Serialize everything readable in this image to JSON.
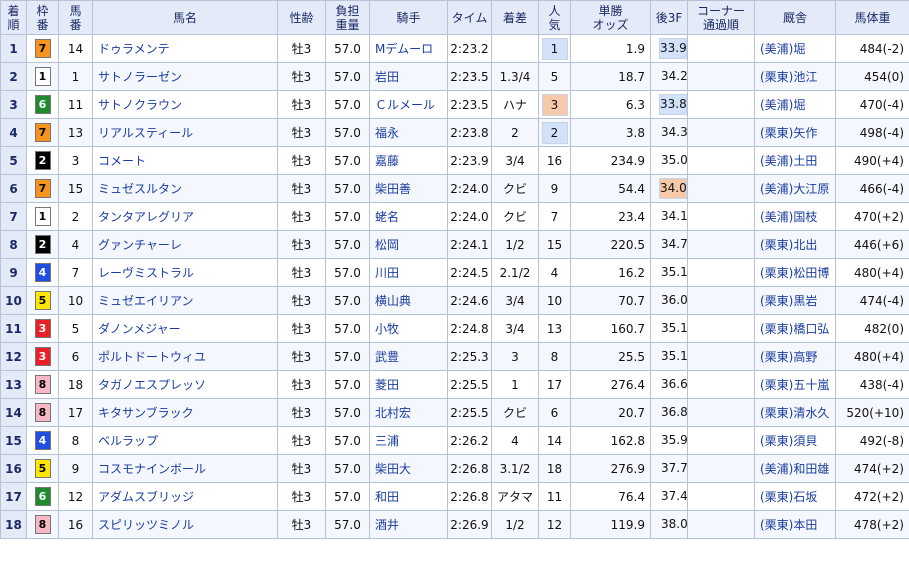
{
  "headers": {
    "rank": [
      "着",
      "順"
    ],
    "frame": [
      "枠",
      "番"
    ],
    "num": [
      "馬",
      "番"
    ],
    "name": "馬名",
    "sexage": "性齢",
    "weight": [
      "負担",
      "重量"
    ],
    "jockey": "騎手",
    "time": "タイム",
    "margin": "着差",
    "pop": [
      "人",
      "気"
    ],
    "odds": [
      "単勝",
      "オッズ"
    ],
    "last3f": "後3F",
    "corner": [
      "コーナー",
      "通過順"
    ],
    "trainer": "厩舎",
    "bodyweight": "馬体重"
  },
  "frame_colors": {
    "1": {
      "bg": "#ffffff",
      "fg": "#000000"
    },
    "2": {
      "bg": "#000000",
      "fg": "#ffffff"
    },
    "3": {
      "bg": "#e8202a",
      "fg": "#ffffff"
    },
    "4": {
      "bg": "#1f4ee0",
      "fg": "#ffffff"
    },
    "5": {
      "bg": "#ffe600",
      "fg": "#000000"
    },
    "6": {
      "bg": "#1f8a2e",
      "fg": "#ffffff"
    },
    "7": {
      "bg": "#f7941d",
      "fg": "#000000"
    },
    "8": {
      "bg": "#f5b8c4",
      "fg": "#000000"
    }
  },
  "highlight_colors": {
    "first": "#d2e2fb",
    "second": "#d2e2fb",
    "third": "#f6c9a8",
    "last_first": "#d2e2fb",
    "last_third": "#f6c9a8"
  },
  "rows": [
    {
      "rank": "1",
      "frame": "7",
      "num": "14",
      "name": "ドゥラメンテ",
      "sexage": "牡3",
      "weight": "57.0",
      "jockey": "Mデムーロ",
      "time": "2:23.2",
      "margin": "",
      "pop": "1",
      "pop_hl": "first",
      "odds": "1.9",
      "last3f": "33.9",
      "last_hl": "last_first",
      "corner": "",
      "trainer": "(美浦)堀",
      "bodyweight": "484(-2)"
    },
    {
      "rank": "2",
      "frame": "1",
      "num": "1",
      "name": "サトノラーゼン",
      "sexage": "牡3",
      "weight": "57.0",
      "jockey": "岩田",
      "time": "2:23.5",
      "margin": "1.3/4",
      "pop": "5",
      "pop_hl": "",
      "odds": "18.7",
      "last3f": "34.2",
      "last_hl": "",
      "corner": "",
      "trainer": "(栗東)池江",
      "bodyweight": "454(0)"
    },
    {
      "rank": "3",
      "frame": "6",
      "num": "11",
      "name": "サトノクラウン",
      "sexage": "牡3",
      "weight": "57.0",
      "jockey": "Ｃルメール",
      "time": "2:23.5",
      "margin": "ハナ",
      "pop": "3",
      "pop_hl": "third",
      "odds": "6.3",
      "last3f": "33.8",
      "last_hl": "last_first",
      "corner": "",
      "trainer": "(美浦)堀",
      "bodyweight": "470(-4)"
    },
    {
      "rank": "4",
      "frame": "7",
      "num": "13",
      "name": "リアルスティール",
      "sexage": "牡3",
      "weight": "57.0",
      "jockey": "福永",
      "time": "2:23.8",
      "margin": "2",
      "pop": "2",
      "pop_hl": "second",
      "odds": "3.8",
      "last3f": "34.3",
      "last_hl": "",
      "corner": "",
      "trainer": "(栗東)矢作",
      "bodyweight": "498(-4)"
    },
    {
      "rank": "5",
      "frame": "2",
      "num": "3",
      "name": "コメート",
      "sexage": "牡3",
      "weight": "57.0",
      "jockey": "嘉藤",
      "time": "2:23.9",
      "margin": "3/4",
      "pop": "16",
      "pop_hl": "",
      "odds": "234.9",
      "last3f": "35.0",
      "last_hl": "",
      "corner": "",
      "trainer": "(美浦)土田",
      "bodyweight": "490(+4)"
    },
    {
      "rank": "6",
      "frame": "7",
      "num": "15",
      "name": "ミュゼスルタン",
      "sexage": "牡3",
      "weight": "57.0",
      "jockey": "柴田善",
      "time": "2:24.0",
      "margin": "クビ",
      "pop": "9",
      "pop_hl": "",
      "odds": "54.4",
      "last3f": "34.0",
      "last_hl": "last_third",
      "corner": "",
      "trainer": "(美浦)大江原",
      "bodyweight": "466(-4)"
    },
    {
      "rank": "7",
      "frame": "1",
      "num": "2",
      "name": "タンタアレグリア",
      "sexage": "牡3",
      "weight": "57.0",
      "jockey": "蛯名",
      "time": "2:24.0",
      "margin": "クビ",
      "pop": "7",
      "pop_hl": "",
      "odds": "23.4",
      "last3f": "34.1",
      "last_hl": "",
      "corner": "",
      "trainer": "(美浦)国枝",
      "bodyweight": "470(+2)"
    },
    {
      "rank": "8",
      "frame": "2",
      "num": "4",
      "name": "グァンチャーレ",
      "sexage": "牡3",
      "weight": "57.0",
      "jockey": "松岡",
      "time": "2:24.1",
      "margin": "1/2",
      "pop": "15",
      "pop_hl": "",
      "odds": "220.5",
      "last3f": "34.7",
      "last_hl": "",
      "corner": "",
      "trainer": "(栗東)北出",
      "bodyweight": "446(+6)"
    },
    {
      "rank": "9",
      "frame": "4",
      "num": "7",
      "name": "レーヴミストラル",
      "sexage": "牡3",
      "weight": "57.0",
      "jockey": "川田",
      "time": "2:24.5",
      "margin": "2.1/2",
      "pop": "4",
      "pop_hl": "",
      "odds": "16.2",
      "last3f": "35.1",
      "last_hl": "",
      "corner": "",
      "trainer": "(栗東)松田博",
      "bodyweight": "480(+4)"
    },
    {
      "rank": "10",
      "frame": "5",
      "num": "10",
      "name": "ミュゼエイリアン",
      "sexage": "牡3",
      "weight": "57.0",
      "jockey": "横山典",
      "time": "2:24.6",
      "margin": "3/4",
      "pop": "10",
      "pop_hl": "",
      "odds": "70.7",
      "last3f": "36.0",
      "last_hl": "",
      "corner": "",
      "trainer": "(栗東)黒岩",
      "bodyweight": "474(-4)"
    },
    {
      "rank": "11",
      "frame": "3",
      "num": "5",
      "name": "ダノンメジャー",
      "sexage": "牡3",
      "weight": "57.0",
      "jockey": "小牧",
      "time": "2:24.8",
      "margin": "3/4",
      "pop": "13",
      "pop_hl": "",
      "odds": "160.7",
      "last3f": "35.1",
      "last_hl": "",
      "corner": "",
      "trainer": "(栗東)橋口弘",
      "bodyweight": "482(0)"
    },
    {
      "rank": "12",
      "frame": "3",
      "num": "6",
      "name": "ポルトドートウィユ",
      "sexage": "牡3",
      "weight": "57.0",
      "jockey": "武豊",
      "time": "2:25.3",
      "margin": "3",
      "pop": "8",
      "pop_hl": "",
      "odds": "25.5",
      "last3f": "35.1",
      "last_hl": "",
      "corner": "",
      "trainer": "(栗東)高野",
      "bodyweight": "480(+4)"
    },
    {
      "rank": "13",
      "frame": "8",
      "num": "18",
      "name": "タガノエスプレッソ",
      "sexage": "牡3",
      "weight": "57.0",
      "jockey": "菱田",
      "time": "2:25.5",
      "margin": "1",
      "pop": "17",
      "pop_hl": "",
      "odds": "276.4",
      "last3f": "36.6",
      "last_hl": "",
      "corner": "",
      "trainer": "(栗東)五十嵐",
      "bodyweight": "438(-4)"
    },
    {
      "rank": "14",
      "frame": "8",
      "num": "17",
      "name": "キタサンブラック",
      "sexage": "牡3",
      "weight": "57.0",
      "jockey": "北村宏",
      "time": "2:25.5",
      "margin": "クビ",
      "pop": "6",
      "pop_hl": "",
      "odds": "20.7",
      "last3f": "36.8",
      "last_hl": "",
      "corner": "",
      "trainer": "(栗東)清水久",
      "bodyweight": "520(+10)"
    },
    {
      "rank": "15",
      "frame": "4",
      "num": "8",
      "name": "ベルラップ",
      "sexage": "牡3",
      "weight": "57.0",
      "jockey": "三浦",
      "time": "2:26.2",
      "margin": "4",
      "pop": "14",
      "pop_hl": "",
      "odds": "162.8",
      "last3f": "35.9",
      "last_hl": "",
      "corner": "",
      "trainer": "(栗東)須貝",
      "bodyweight": "492(-8)"
    },
    {
      "rank": "16",
      "frame": "5",
      "num": "9",
      "name": "コスモナインボール",
      "sexage": "牡3",
      "weight": "57.0",
      "jockey": "柴田大",
      "time": "2:26.8",
      "margin": "3.1/2",
      "pop": "18",
      "pop_hl": "",
      "odds": "276.9",
      "last3f": "37.7",
      "last_hl": "",
      "corner": "",
      "trainer": "(美浦)和田雄",
      "bodyweight": "474(+2)"
    },
    {
      "rank": "17",
      "frame": "6",
      "num": "12",
      "name": "アダムスブリッジ",
      "sexage": "牡3",
      "weight": "57.0",
      "jockey": "和田",
      "time": "2:26.8",
      "margin": "アタマ",
      "pop": "11",
      "pop_hl": "",
      "odds": "76.4",
      "last3f": "37.4",
      "last_hl": "",
      "corner": "",
      "trainer": "(栗東)石坂",
      "bodyweight": "472(+2)"
    },
    {
      "rank": "18",
      "frame": "8",
      "num": "16",
      "name": "スピリッツミノル",
      "sexage": "牡3",
      "weight": "57.0",
      "jockey": "酒井",
      "time": "2:26.9",
      "margin": "1/2",
      "pop": "12",
      "pop_hl": "",
      "odds": "119.9",
      "last3f": "38.0",
      "last_hl": "",
      "corner": "",
      "trainer": "(栗東)本田",
      "bodyweight": "478(+2)"
    }
  ]
}
